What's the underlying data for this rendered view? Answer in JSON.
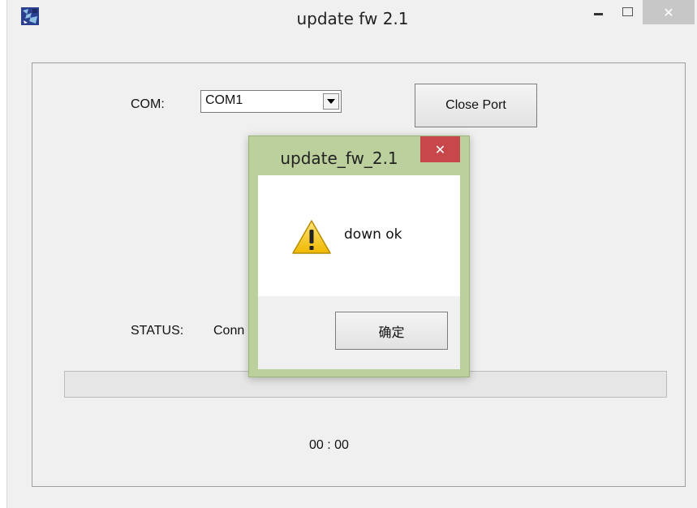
{
  "window": {
    "title": "update fw 2.1",
    "close_glyph": "✕"
  },
  "form": {
    "com_label": "COM:",
    "com_selected": "COM1",
    "close_port_label": "Close Port",
    "status_label": "STATUS:",
    "status_value": "Conn",
    "timer": "00 : 00",
    "progress": 0
  },
  "dialog": {
    "title": "update_fw_2.1",
    "close_glyph": "✕",
    "message": "down ok",
    "ok_label": "确定",
    "icon": "warning-icon"
  },
  "colors": {
    "dialog_frame": "#bcd09d",
    "dialog_close": "#c7474a",
    "window_close": "#c7c7c7",
    "warning_yellow": "#f5c518"
  }
}
